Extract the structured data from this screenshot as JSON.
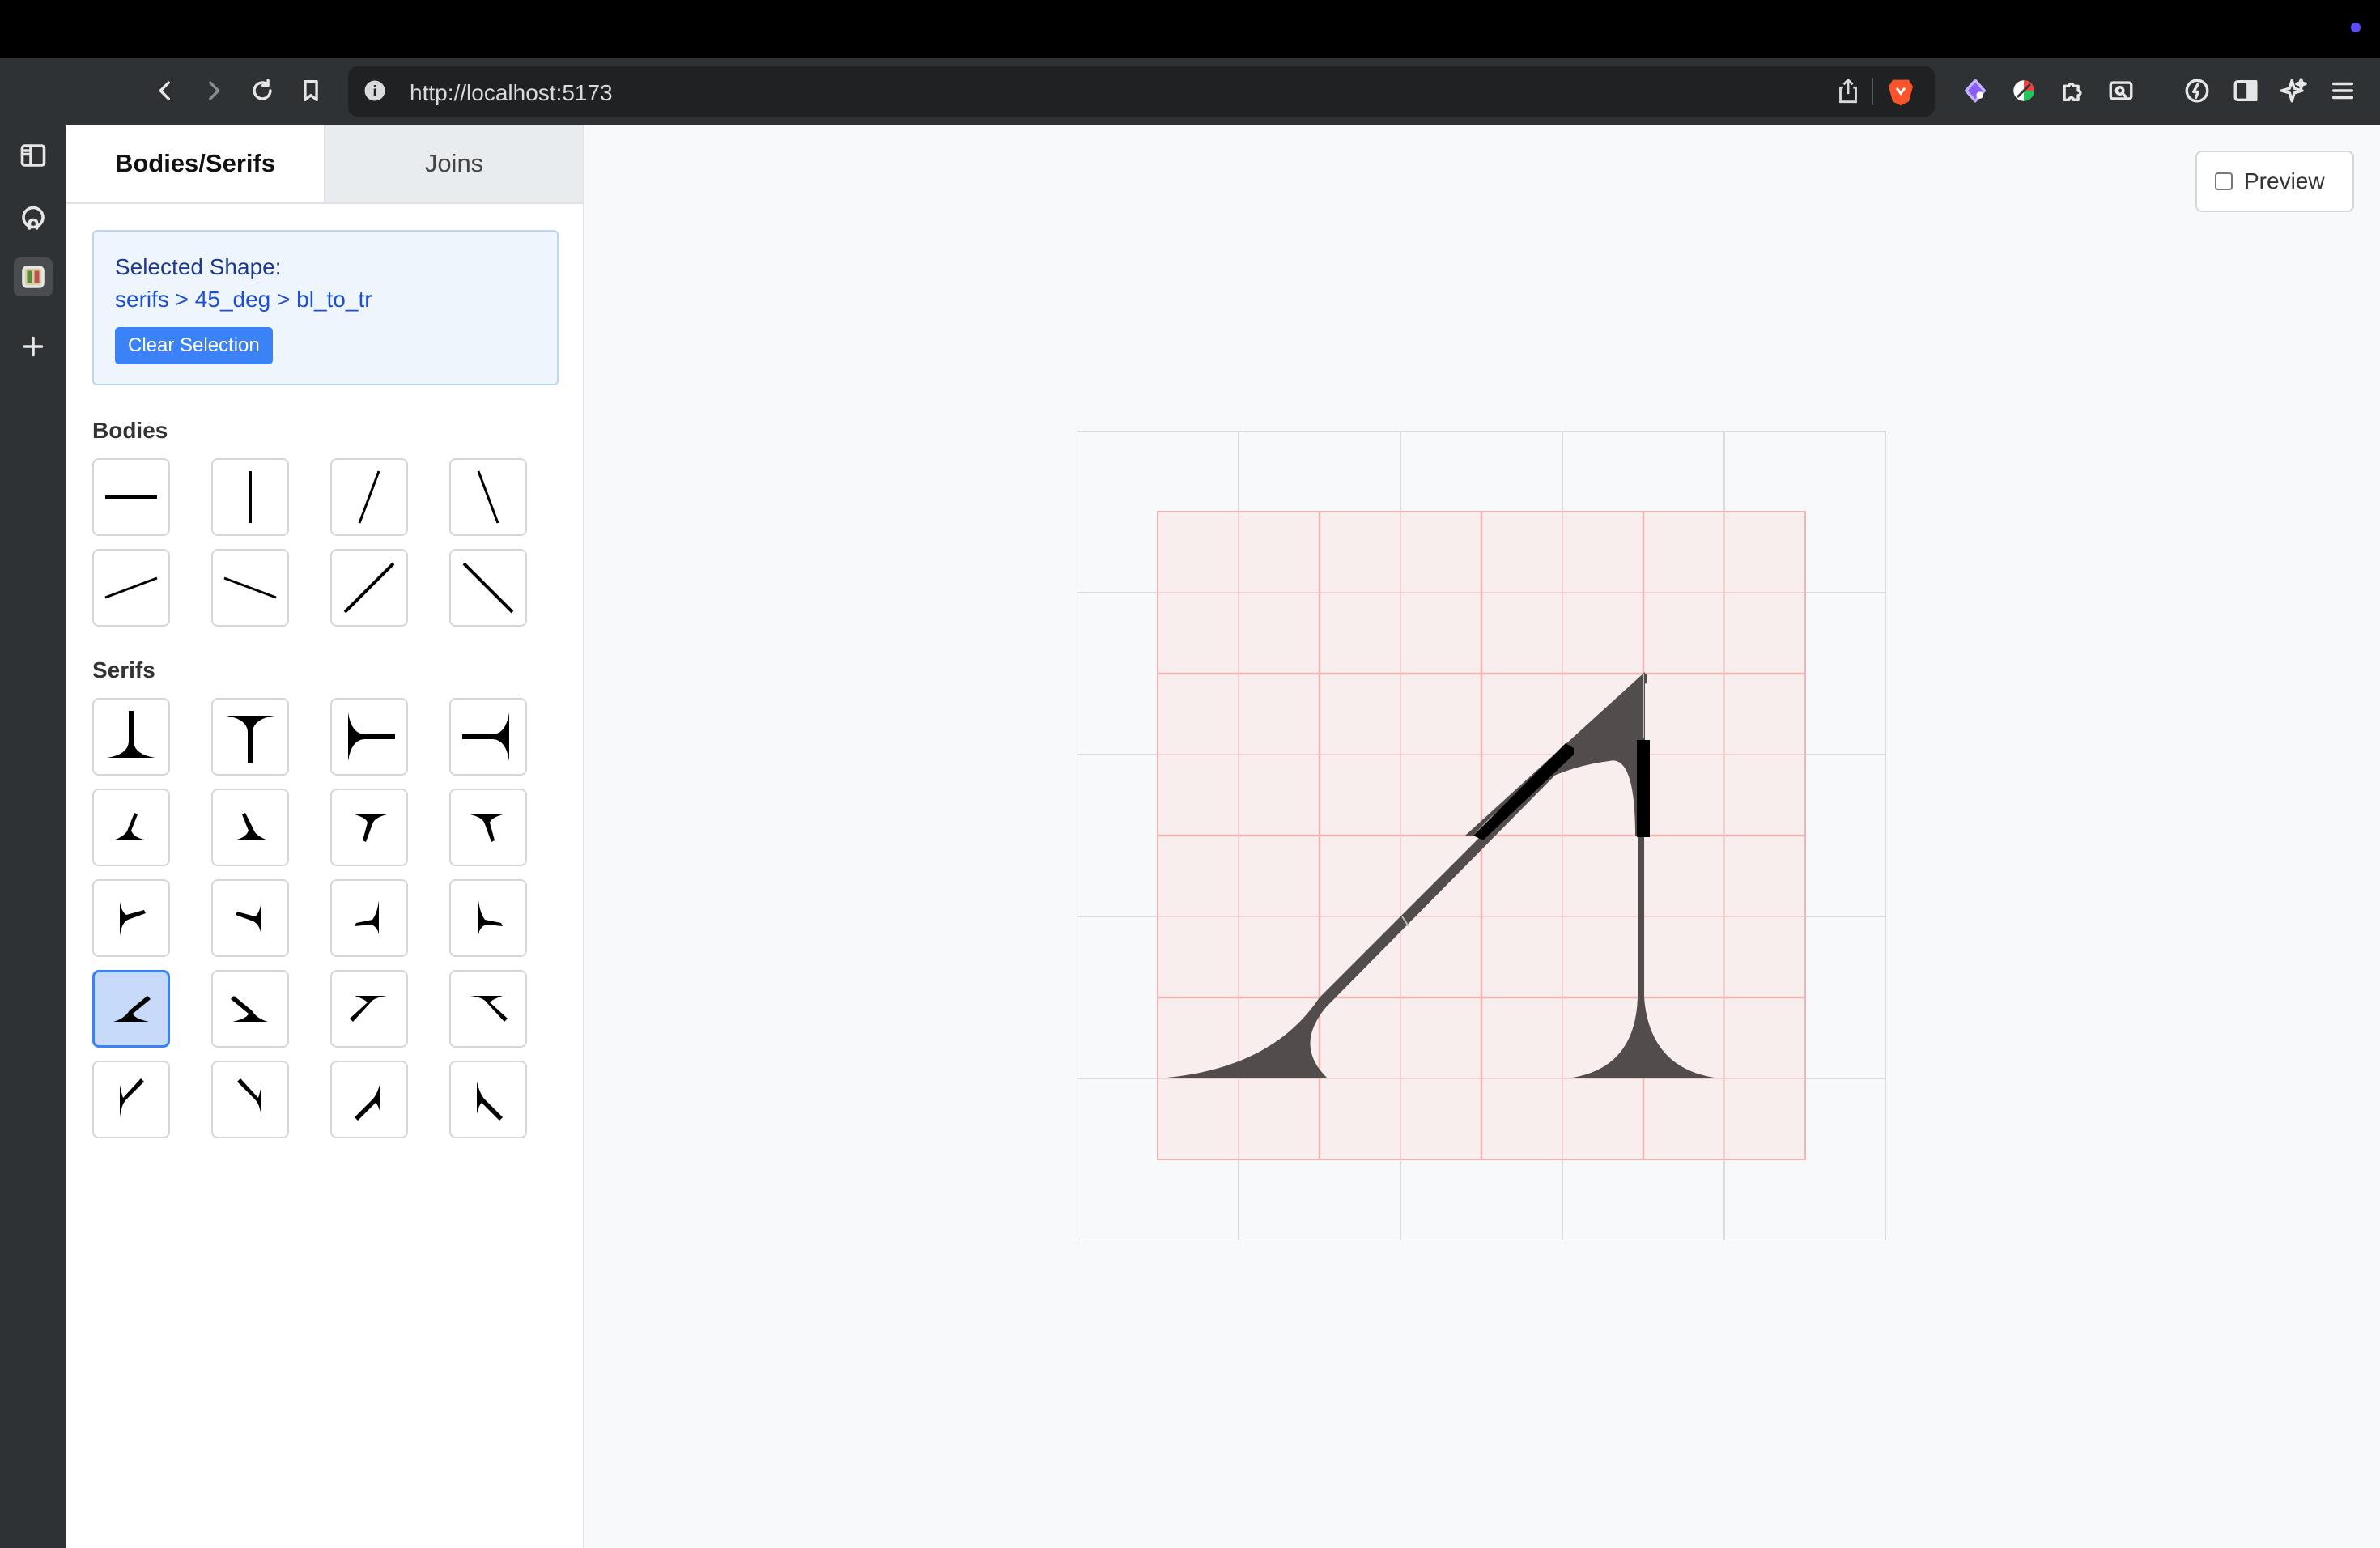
{
  "browser": {
    "url": "http://localhost:5173"
  },
  "tabs": [
    {
      "label": "Bodies/Serifs",
      "active": true
    },
    {
      "label": "Joins",
      "active": false
    }
  ],
  "selection": {
    "title": "Selected Shape:",
    "path": "serifs > 45_deg > bl_to_tr",
    "clear_label": "Clear Selection"
  },
  "bodies": {
    "title": "Bodies",
    "items": [
      "horizontal",
      "vertical",
      "slash",
      "backslash",
      "shallow-up",
      "shallow-down",
      "diagonal-up",
      "diagonal-down"
    ]
  },
  "serifs": {
    "title": "Serifs",
    "selected_index": 12,
    "items": [
      "serif-bottom",
      "serif-top",
      "serif-left",
      "serif-right",
      "serif-1",
      "serif-2",
      "serif-3",
      "serif-4",
      "serif-5",
      "serif-6",
      "serif-7",
      "serif-8",
      "serif-45-bl-to-tr",
      "serif-10",
      "serif-11",
      "serif-12",
      "serif-13",
      "serif-14",
      "serif-15",
      "serif-16"
    ]
  },
  "preview": {
    "label": "Preview",
    "checked": false
  },
  "colors": {
    "accent": "#3b82f6",
    "grid_pink": "#f0b4b4",
    "glyph": "#524c4c"
  }
}
